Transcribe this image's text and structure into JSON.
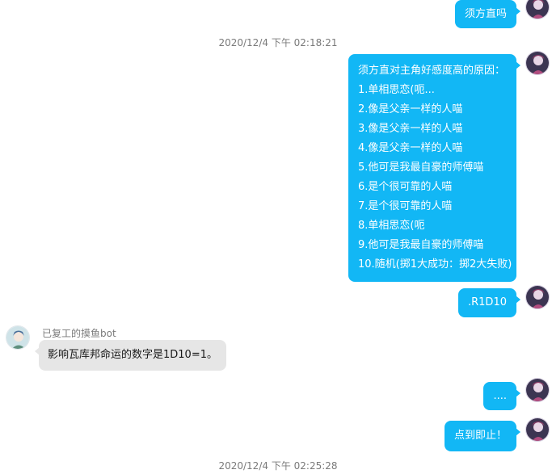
{
  "timestamps": [
    "2020/12/4 下午 02:18:21",
    "2020/12/4 下午 02:25:28"
  ],
  "messages": {
    "m1": {
      "text": "须方直吗"
    },
    "m2": {
      "lines": [
        "须方直对主角好感度高的原因：",
        "1.单相思恋(呃...",
        "2.像是父亲一样的人喵",
        "3.像是父亲一样的人喵",
        "4.像是父亲一样的人喵",
        "5.他可是我最自豪的师傅喵",
        "6.是个很可靠的人喵",
        "7.是个很可靠的人喵",
        "8.单相思恋(呃",
        "9.他可是我最自豪的师傅喵",
        "10.随机(掷1大成功：掷2大失败)"
      ]
    },
    "m3": {
      "text": ".R1D10"
    },
    "m4": {
      "sender": "已复工的摸鱼bot",
      "text": "影响瓦库邦命运的数字是1D10=1。"
    },
    "m5": {
      "text": "...."
    },
    "m6": {
      "text": "点到即止！"
    }
  },
  "colors": {
    "self_bubble": "#12b7f5",
    "other_bubble": "#e6e6e6",
    "timestamp": "#7a7a7a"
  },
  "icons": {
    "self_avatar": "anime-character-avatar",
    "bot_avatar": "anime-character-avatar"
  }
}
